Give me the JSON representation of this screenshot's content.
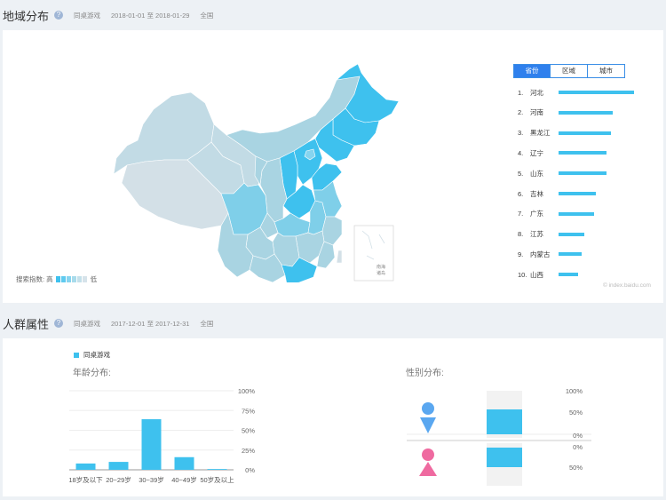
{
  "region": {
    "title": "地域分布",
    "help_glyph": "?",
    "keyword": "同桌游戏",
    "date_range": "2018-01-01 至 2018-01-29",
    "scope": "全国",
    "tabs": [
      {
        "label": "省份",
        "active": true
      },
      {
        "label": "区域",
        "active": false
      },
      {
        "label": "城市",
        "active": false
      }
    ],
    "ranking": [
      {
        "rank": "1.",
        "name": "河北",
        "level": 1.0
      },
      {
        "rank": "2.",
        "name": "河南",
        "level": 0.72
      },
      {
        "rank": "3.",
        "name": "黑龙江",
        "level": 0.69
      },
      {
        "rank": "4.",
        "name": "辽宁",
        "level": 0.63
      },
      {
        "rank": "5.",
        "name": "山东",
        "level": 0.63
      },
      {
        "rank": "6.",
        "name": "吉林",
        "level": 0.49
      },
      {
        "rank": "7.",
        "name": "广东",
        "level": 0.47
      },
      {
        "rank": "8.",
        "name": "江苏",
        "level": 0.34
      },
      {
        "rank": "9.",
        "name": "内蒙古",
        "level": 0.31
      },
      {
        "rank": "10.",
        "name": "山西",
        "level": 0.26
      }
    ],
    "legend": {
      "label": "搜索指数:",
      "high": "高",
      "low": "低",
      "colors": [
        "#3ec1ee",
        "#5fcaef",
        "#86d4ef",
        "#a8dbeb",
        "#c4e0ea",
        "#d6e3ea"
      ]
    },
    "inset_label_1": "南海",
    "inset_label_2": "诸岛",
    "watermark": "© index.baidu.com",
    "map_colors": {
      "high": "#3ec1ee",
      "mid": "#7fcfe9",
      "low": "#a9d4e2",
      "lower": "#c2dbe5",
      "lowest": "#d3e0e7"
    }
  },
  "crowd": {
    "title": "人群属性",
    "help_glyph": "?",
    "keyword": "同桌游戏",
    "date_range": "2017-12-01 至 2017-12-31",
    "scope": "全国",
    "series_name": "同桌游戏",
    "age_title": "年龄分布:",
    "gender_title": "性别分布:"
  },
  "chart_data": [
    {
      "type": "bar",
      "title": "年龄分布:",
      "categories": [
        "18岁及以下",
        "20~29岁",
        "30~39岁",
        "40~49岁",
        "50岁及以上"
      ],
      "series": [
        {
          "name": "同桌游戏",
          "values": [
            8,
            10,
            64,
            16,
            1
          ]
        }
      ],
      "ylim": [
        0,
        100
      ],
      "yticks": [
        "100%",
        "75%",
        "50%",
        "25%",
        "0%"
      ],
      "color": "#3ec1ee",
      "grid": true
    },
    {
      "type": "bar",
      "title": "性别分布:",
      "categories": [
        "男",
        "女"
      ],
      "series": [
        {
          "name": "同桌游戏",
          "values": [
            56,
            44
          ]
        }
      ],
      "ylim": [
        0,
        100
      ],
      "yticks_top": [
        "100%",
        "50%",
        "0%"
      ],
      "yticks_bottom": [
        "0%",
        "50%"
      ],
      "male_color": "#5aa7f0",
      "female_color": "#ef6aa0",
      "bar_color": "#3ec1ee"
    }
  ]
}
